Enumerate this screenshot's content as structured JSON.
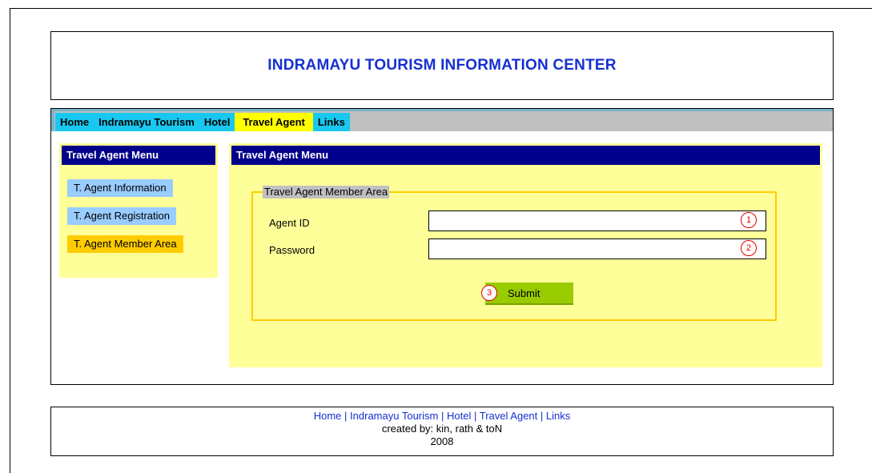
{
  "header": {
    "title": "INDRAMAYU TOURISM INFORMATION CENTER"
  },
  "nav": {
    "items": [
      {
        "label": "Home"
      },
      {
        "label": "Indramayu Tourism"
      },
      {
        "label": "Hotel"
      },
      {
        "label": "Travel Agent",
        "active": true
      },
      {
        "label": "Links"
      }
    ]
  },
  "sidebar": {
    "title": "Travel Agent Menu",
    "items": [
      {
        "label": "T. Agent Information"
      },
      {
        "label": "T. Agent Registration"
      },
      {
        "label": "T. Agent Member Area",
        "active": true
      }
    ]
  },
  "main": {
    "title": "Travel Agent Menu",
    "form": {
      "legend": "Travel Agent Member Area",
      "agent_id_label": "Agent ID",
      "agent_id_value": "",
      "password_label": "Password",
      "password_value": "",
      "submit_label": "Submit",
      "markers": [
        "1",
        "2",
        "3"
      ]
    }
  },
  "footer": {
    "links": [
      "Home",
      "Indramayu Tourism",
      "Hotel",
      "Travel Agent",
      "Links"
    ],
    "separator": "|",
    "credits": "created by: kin, rath & toN",
    "year": "2008"
  },
  "colors": {
    "title_blue": "#1530d0",
    "panel_yellow": "#ffff99",
    "header_navy": "#00008b",
    "nav_cyan": "#18c8f0",
    "active_yellow": "#ffff00",
    "submit_green": "#99cc00",
    "marker_red": "#e00000"
  }
}
